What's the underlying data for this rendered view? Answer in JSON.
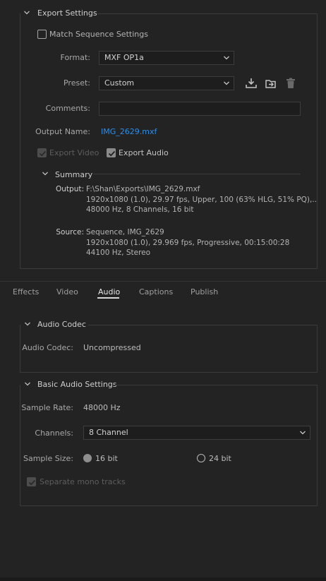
{
  "export_settings": {
    "title": "Export Settings",
    "match_sequence_label": "Match Sequence Settings",
    "format_label": "Format:",
    "format_value": "MXF OP1a",
    "preset_label": "Preset:",
    "preset_value": "Custom",
    "comments_label": "Comments:",
    "comments_value": "",
    "output_name_label": "Output Name:",
    "output_name_value": "IMG_2629.mxf",
    "export_video_label": "Export Video",
    "export_audio_label": "Export Audio",
    "summary_title": "Summary",
    "output_key": "Output:",
    "output_lines": [
      "F:\\Shan\\Exports\\IMG_2629.mxf",
      "1920x1080 (1.0), 29.97 fps, Upper, 100 (63% HLG, 51% PQ),..",
      "48000 Hz, 8 Channels, 16 bit"
    ],
    "source_key": "Source:",
    "source_lines": [
      "Sequence, IMG_2629",
      "1920x1080 (1.0), 29.969 fps, Progressive, 00:15:00:28",
      "44100 Hz, Stereo"
    ]
  },
  "tabs": [
    {
      "label": "Effects"
    },
    {
      "label": "Video"
    },
    {
      "label": "Audio"
    },
    {
      "label": "Captions"
    },
    {
      "label": "Publish"
    }
  ],
  "active_tab": "Audio",
  "audio_codec": {
    "title": "Audio Codec",
    "codec_label": "Audio Codec:",
    "codec_value": "Uncompressed"
  },
  "basic_audio": {
    "title": "Basic Audio Settings",
    "sample_rate_label": "Sample Rate:",
    "sample_rate_value": "48000 Hz",
    "channels_label": "Channels:",
    "channels_value": "8 Channel",
    "sample_size_label": "Sample Size:",
    "sample_size_options": [
      "16 bit",
      "24 bit"
    ],
    "sample_size_selected": "16 bit",
    "separate_mono_label": "Separate mono tracks"
  },
  "colors": {
    "background": "#232323",
    "link": "#2e8ee6",
    "text": "#b9b9b9"
  }
}
